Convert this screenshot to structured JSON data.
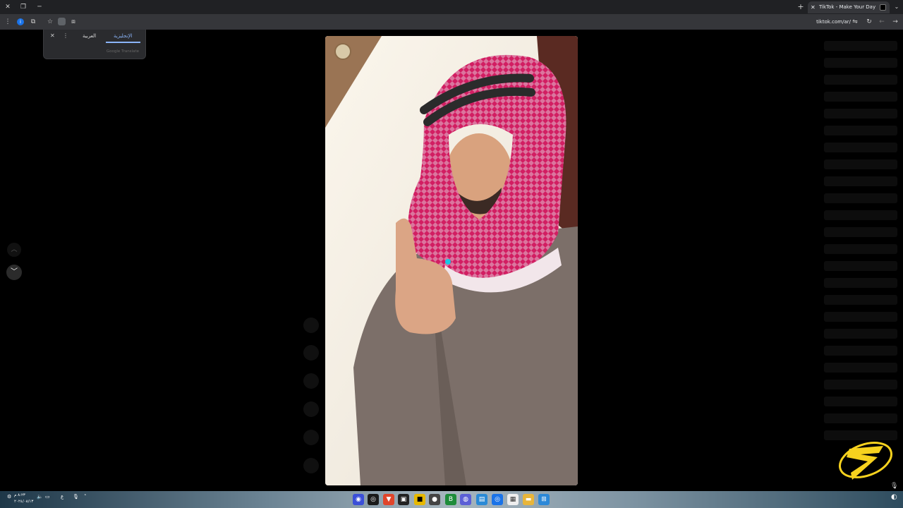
{
  "browser": {
    "tab_title": "TikTok - Make Your Day",
    "url": "tiktok.com/ar/",
    "icons": [
      "close-icon",
      "restore-icon",
      "minimize-icon",
      "new-tab-icon",
      "tab-list-icon"
    ]
  },
  "translate_popup": {
    "source_language": "العربية",
    "target_language": "الإنجليزية",
    "credit": "Google Translate"
  },
  "navigation": {
    "up_icon": "chevron-up-icon",
    "down_icon": "chevron-down-icon"
  },
  "taskbar": {
    "clock_time": "٨:٢٣ م",
    "clock_date": "٢٠٢٤/٠٨/١٣",
    "lang_indicator": "ع"
  },
  "colors": {
    "accent": "#8ab4f8",
    "logo_yellow": "#f7d21e",
    "background": "#000000"
  }
}
